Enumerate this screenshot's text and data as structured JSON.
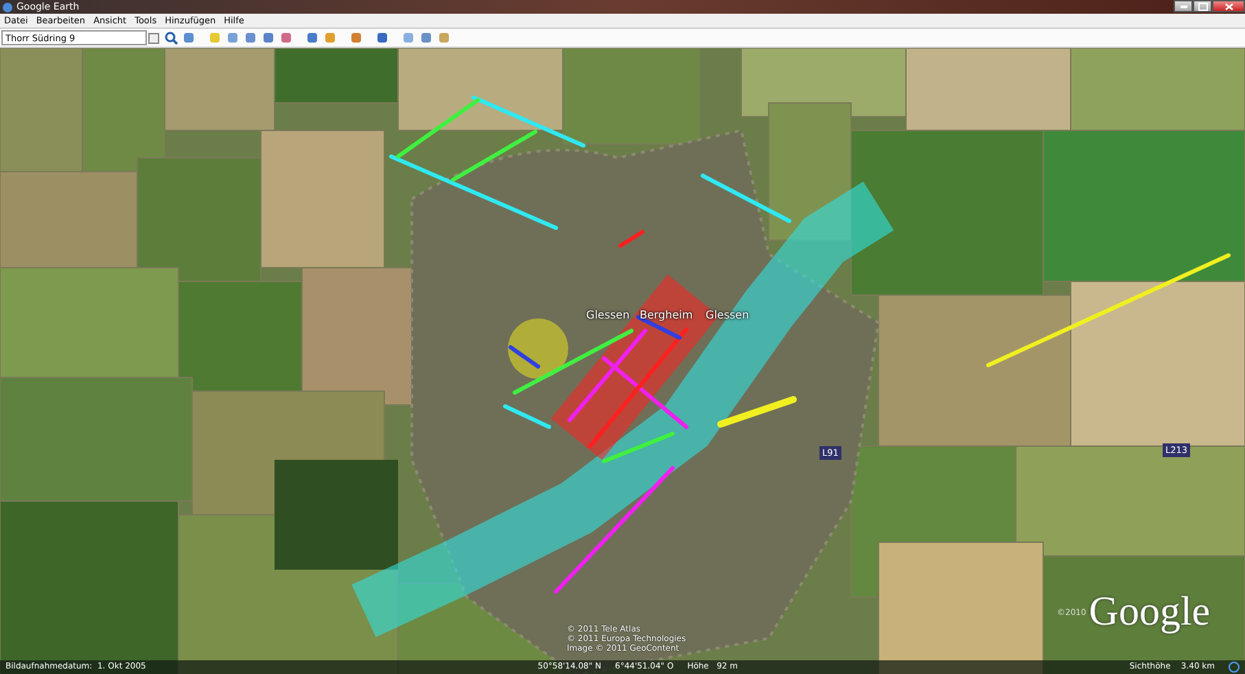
{
  "window": {
    "title": "Google Earth"
  },
  "menu": [
    "Datei",
    "Bearbeiten",
    "Ansicht",
    "Tools",
    "Hinzufügen",
    "Hilfe"
  ],
  "search": {
    "value": "Thorr Südring 9"
  },
  "map_labels": [
    {
      "text": "Glessen",
      "kind": "place"
    },
    {
      "text": "Bergheim",
      "kind": "place"
    },
    {
      "text": "Glessen",
      "kind": "place"
    },
    {
      "text": "L91",
      "kind": "road"
    },
    {
      "text": "L213",
      "kind": "road"
    }
  ],
  "attribution": [
    "© 2011 Tele Atlas",
    "© 2011 Europa Technologies",
    "Image © 2011 GeoContent"
  ],
  "logo": {
    "copyright": "©2010",
    "brand": "Google"
  },
  "status_bar": {
    "date": "Bildaufnahmedatum:  1. Okt 2005",
    "lat": "50°58'14.08\" N",
    "lon": "6°44'51.04\" O",
    "elevation": "Höhe   92 m",
    "eye_alt": "Sichthöhe    3.40 km"
  }
}
